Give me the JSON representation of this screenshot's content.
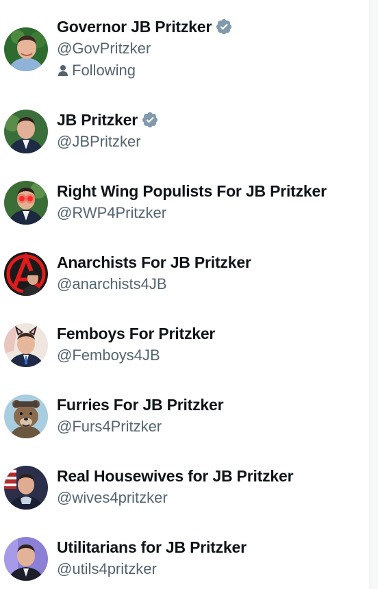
{
  "colors": {
    "name": "#0f1419",
    "handle": "#536471",
    "verified_badge": "#829aab",
    "divider": "#eff3f4"
  },
  "accounts": [
    {
      "name": "Governor JB Pritzker",
      "handle": "@GovPritzker",
      "verified": true,
      "following_label": "Following",
      "avatar_bg": "#2e6b2f"
    },
    {
      "name": "JB Pritzker",
      "handle": "@JBPritzker",
      "verified": true,
      "avatar_bg": "#3a6e3a"
    },
    {
      "name": "Right Wing Populists For JB Pritzker",
      "handle": "@RWP4Pritzker",
      "verified": false,
      "avatar_bg": "#3b6d37"
    },
    {
      "name": "Anarchists For JB Pritzker",
      "handle": "@anarchists4JB",
      "verified": false,
      "avatar_bg": "#1a1a1a"
    },
    {
      "name": "Femboys For Pritzker",
      "handle": "@Femboys4JB",
      "verified": false,
      "avatar_bg": "#f0e6e0"
    },
    {
      "name": "Furries For JB Pritzker",
      "handle": "@Furs4Pritzker",
      "verified": false,
      "avatar_bg": "#a9cde0"
    },
    {
      "name": "Real Housewives for JB Pritzker",
      "handle": "@wives4pritzker",
      "verified": false,
      "avatar_bg": "#2b2f4a"
    },
    {
      "name": "Utilitarians for JB Pritzker",
      "handle": "@utils4pritzker",
      "verified": false,
      "avatar_bg": "#8b7fd6"
    }
  ]
}
